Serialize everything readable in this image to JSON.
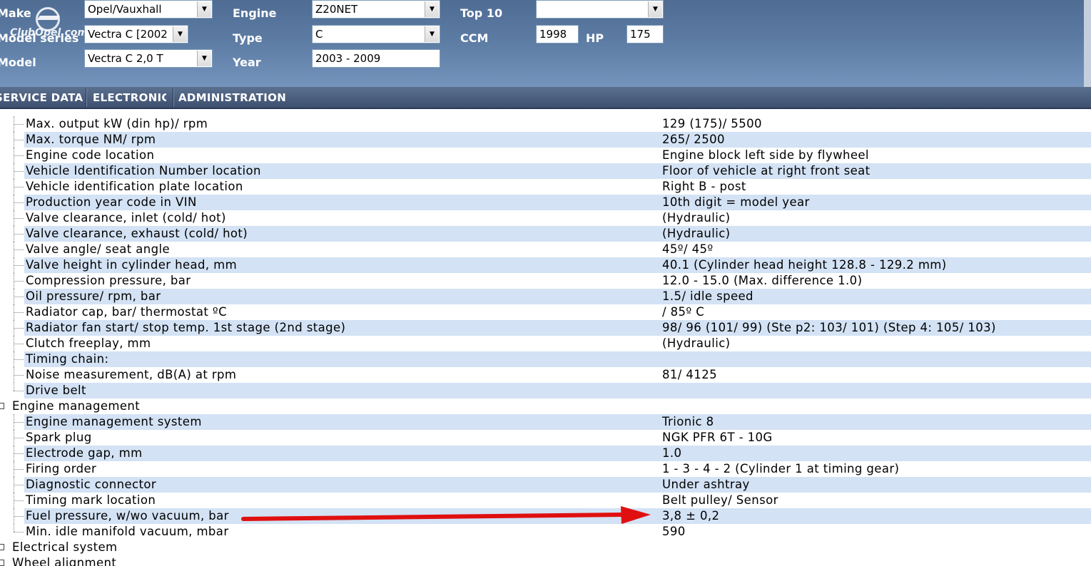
{
  "header": {
    "logo_text": "ClubOpel.com",
    "labels": {
      "make": "Make",
      "model_series": "Model series",
      "model": "Model",
      "engine": "Engine",
      "type": "Type",
      "year": "Year",
      "top10": "Top 10",
      "ccm": "CCM",
      "hp": "HP"
    },
    "fields": {
      "make": "Opel/Vauxhall",
      "model_series": "Vectra C [2002",
      "model": "Vectra C 2,0 T",
      "engine": "Z20NET",
      "type": "C",
      "year": "2003 - 2009",
      "top10": "",
      "ccm": "1998",
      "hp": "175"
    },
    "dropdown_arrow": "▼"
  },
  "tabs": [
    {
      "label": "SERVICE DATA"
    },
    {
      "label": "ELECTRONIC"
    },
    {
      "label": "ADMINISTRATION"
    }
  ],
  "tree": {
    "rows": [
      {
        "name": "Max. output kW (din hp)/ rpm",
        "value": "129 (175)/ 5500"
      },
      {
        "name": "Max. torque NM/ rpm",
        "value": "265/ 2500"
      },
      {
        "name": "Engine code location",
        "value": "Engine block left side by flywheel"
      },
      {
        "name": "Vehicle Identification Number location",
        "value": "Floor of vehicle at right front seat"
      },
      {
        "name": "Vehicle identification plate location",
        "value": "Right B - post"
      },
      {
        "name": "Production year code in VIN",
        "value": "10th digit = model year"
      },
      {
        "name": "Valve clearance, inlet (cold/ hot)",
        "value": "(Hydraulic)"
      },
      {
        "name": "Valve clearance, exhaust (cold/ hot)",
        "value": "(Hydraulic)"
      },
      {
        "name": "Valve angle/ seat angle",
        "value": "45º/ 45º"
      },
      {
        "name": "Valve height in cylinder head, mm",
        "value": "40.1 (Cylinder head height 128.8 - 129.2 mm)"
      },
      {
        "name": "Compression pressure, bar",
        "value": "12.0 - 15.0 (Max. difference 1.0)"
      },
      {
        "name": "Oil pressure/ rpm, bar",
        "value": "1.5/ idle speed"
      },
      {
        "name": "Radiator cap, bar/ thermostat ºC",
        "value": "/ 85º C"
      },
      {
        "name": "Radiator fan start/ stop temp. 1st stage (2nd stage)",
        "value": "98/ 96 (101/ 99) (Ste p2: 103/ 101) (Step 4: 105/ 103)"
      },
      {
        "name": "Clutch freeplay, mm",
        "value": "(Hydraulic)"
      },
      {
        "name": "Timing chain:",
        "value": ""
      },
      {
        "name": "Noise measurement, dB(A) at rpm",
        "value": "81/ 4125"
      },
      {
        "name": "Drive belt",
        "value": ""
      },
      {
        "name": "Engine management",
        "value": "",
        "category": true
      },
      {
        "name": "Engine management system",
        "value": "Trionic 8"
      },
      {
        "name": "Spark plug",
        "value": "NGK PFR 6T - 10G"
      },
      {
        "name": "Electrode gap, mm",
        "value": "1.0"
      },
      {
        "name": "Firing order",
        "value": "1 - 3 - 4 - 2 (Cylinder 1 at timing gear)"
      },
      {
        "name": "Diagnostic connector",
        "value": "Under ashtray"
      },
      {
        "name": "Timing mark location",
        "value": "Belt pulley/ Sensor"
      },
      {
        "name": "Fuel pressure, w/wo vacuum, bar",
        "value": "3,8 ± 0,2"
      },
      {
        "name": "Min. idle manifold vacuum, mbar",
        "value": "590"
      },
      {
        "name": "Electrical system",
        "value": "",
        "category": true
      },
      {
        "name": "Wheel alignment",
        "value": "",
        "category": true
      }
    ]
  },
  "colors": {
    "header_bg": "#5c7ba3",
    "tabbar_bg": "#3d5070",
    "row_alt_bg": "#d3e2f4",
    "arrow": "#e01010"
  }
}
